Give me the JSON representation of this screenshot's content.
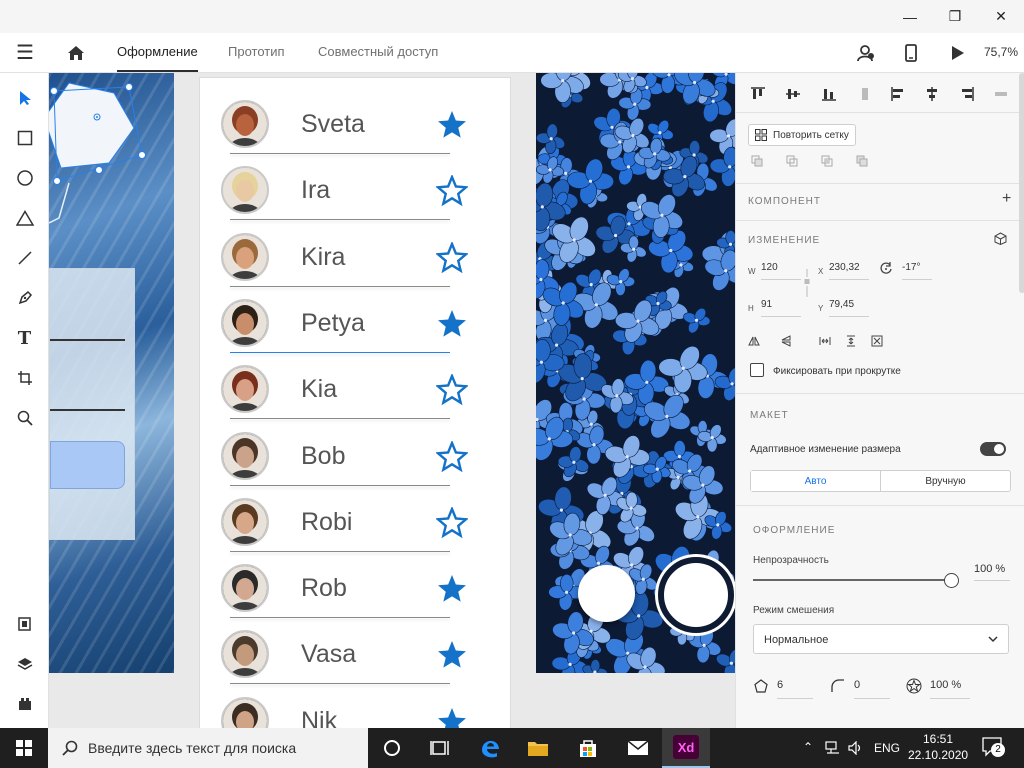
{
  "window": {
    "min": "—",
    "max": "❐",
    "close": "✕"
  },
  "menu": {
    "hamburger": "☰",
    "tabs": [
      {
        "label": "Оформление"
      },
      {
        "label": "Прототип"
      },
      {
        "label": "Совместный доступ"
      }
    ],
    "zoom": "75,7%"
  },
  "canvas": {
    "contacts": [
      {
        "name": "Sveta",
        "starred": true,
        "face": "#b8623e",
        "hair": "#8a3f24"
      },
      {
        "name": "Ira",
        "starred": false,
        "face": "#e9c9a3",
        "hair": "#e6d39b"
      },
      {
        "name": "Kira",
        "starred": false,
        "face": "#d9a27d",
        "hair": "#9b6a3c"
      },
      {
        "name": "Petya",
        "starred": true,
        "face": "#c88d6a",
        "hair": "#2d2117"
      },
      {
        "name": "Kia",
        "starred": false,
        "face": "#d8a086",
        "hair": "#7a2e1c"
      },
      {
        "name": "Bob",
        "starred": false,
        "face": "#cba38a",
        "hair": "#4a3527"
      },
      {
        "name": "Robi",
        "starred": false,
        "face": "#d6a789",
        "hair": "#5b3a22"
      },
      {
        "name": "Rob",
        "starred": true,
        "face": "#d2a890",
        "hair": "#2a2a2a"
      },
      {
        "name": "Vasa",
        "starred": true,
        "face": "#c49a7c",
        "hair": "#4a3b2c"
      },
      {
        "name": "Nik",
        "starred": true,
        "face": "#cfa385",
        "hair": "#3b2d22"
      }
    ],
    "star_color": "#1472c8",
    "selection_color": "#2680eb"
  },
  "panel": {
    "repeat_grid": "Повторить сетку",
    "component_title": "КОМПОНЕНТ",
    "transform_title": "ИЗМЕНЕНИЕ",
    "w_label": "W",
    "w_value": "120",
    "x_label": "X",
    "x_value": "230,32",
    "rot_value": "-17°",
    "h_label": "H",
    "h_value": "91",
    "y_label": "Y",
    "y_value": "79,45",
    "fix_scroll": "Фиксировать при прокрутке",
    "layout_title": "МАКЕТ",
    "responsive_resize": "Адаптивное изменение размера",
    "auto": "Авто",
    "manual": "Вручную",
    "appearance_title": "ОФОРМЛЕНИЕ",
    "opacity_label": "Непрозрачность",
    "opacity_value": "100 %",
    "opacity_level": 1.0,
    "blend_label": "Режим смешения",
    "blend_value": "Нормальное",
    "sides_value": "6",
    "corner_value": "0",
    "star_ratio_value": "100 %"
  },
  "taskbar": {
    "search_placeholder": "Введите здесь текст для поиска",
    "lang": "ENG",
    "time": "16:51",
    "date": "22.10.2020",
    "notif_count": "2",
    "xd_label": "Xd"
  }
}
